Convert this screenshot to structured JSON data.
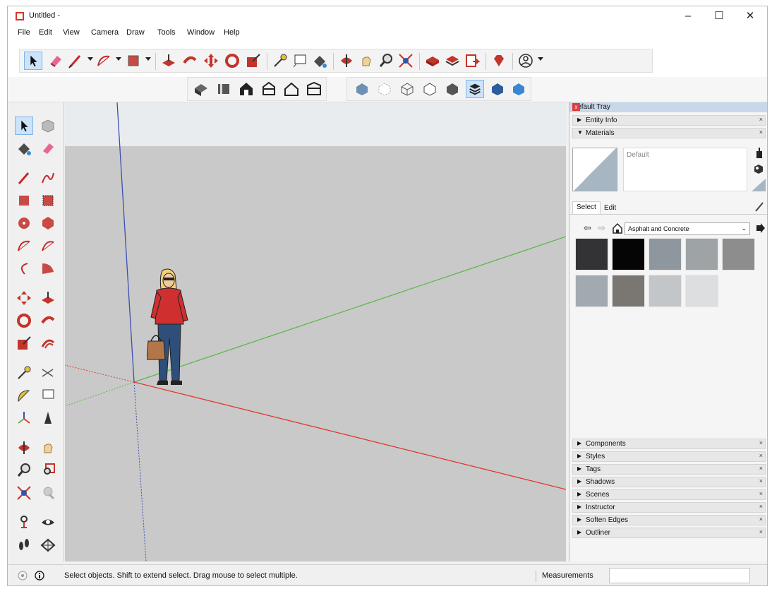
{
  "window": {
    "title": "Untitled -"
  },
  "menu": [
    "File",
    "Edit",
    "View",
    "Camera",
    "Draw",
    "Tools",
    "Window",
    "Help"
  ],
  "toolbar": {
    "main_icons": [
      "select-icon",
      "eraser-icon",
      "pencil-icon",
      "arc-icon",
      "rectangle-icon",
      "push-pull-icon",
      "follow-me-icon",
      "move-icon",
      "rotate-icon",
      "scale-icon",
      "tape-measure-icon",
      "text-icon",
      "paint-bucket-icon",
      "orbit-icon",
      "pan-icon",
      "zoom-icon",
      "zoom-extents-icon",
      "3d-warehouse-icon",
      "extension-warehouse-icon",
      "layout-icon",
      "ruby-icon",
      "profile-icon"
    ],
    "view_icons": [
      "iso-view-icon",
      "top-view-icon",
      "front-view-icon",
      "right-view-icon",
      "back-view-icon",
      "left-view-icon",
      "xray-icon",
      "back-edges-icon",
      "wireframe-icon",
      "hidden-line-icon",
      "shaded-icon",
      "shaded-textures-icon",
      "monochrome-icon"
    ]
  },
  "tray": {
    "title": "Default Tray",
    "panels_top": [
      {
        "label": "Entity Info",
        "expanded": false
      },
      {
        "label": "Materials",
        "expanded": true
      }
    ],
    "materials": {
      "current": "Default",
      "tabs": [
        "Select",
        "Edit"
      ],
      "library": "Asphalt and Concrete",
      "swatch_colors": [
        "#333335",
        "#050505",
        "#8f979e",
        "#9ea3a5",
        "#8d8d8d",
        "#a3aaaf",
        "#7a7672",
        "#c3c6c9",
        "#dcdedf"
      ]
    },
    "panels_bottom": [
      "Components",
      "Styles",
      "Tags",
      "Shadows",
      "Scenes",
      "Instructor",
      "Soften Edges",
      "Outliner"
    ]
  },
  "status": {
    "message": "Select objects. Shift to extend select. Drag mouse to select multiple.",
    "measurements_label": "Measurements"
  },
  "colors": {
    "accent_select": "#cce4fb",
    "axis_red": "#e03a2e",
    "axis_green": "#5bb84a",
    "axis_blue": "#3c4fb0",
    "tray_header": "#c9d7ea"
  }
}
